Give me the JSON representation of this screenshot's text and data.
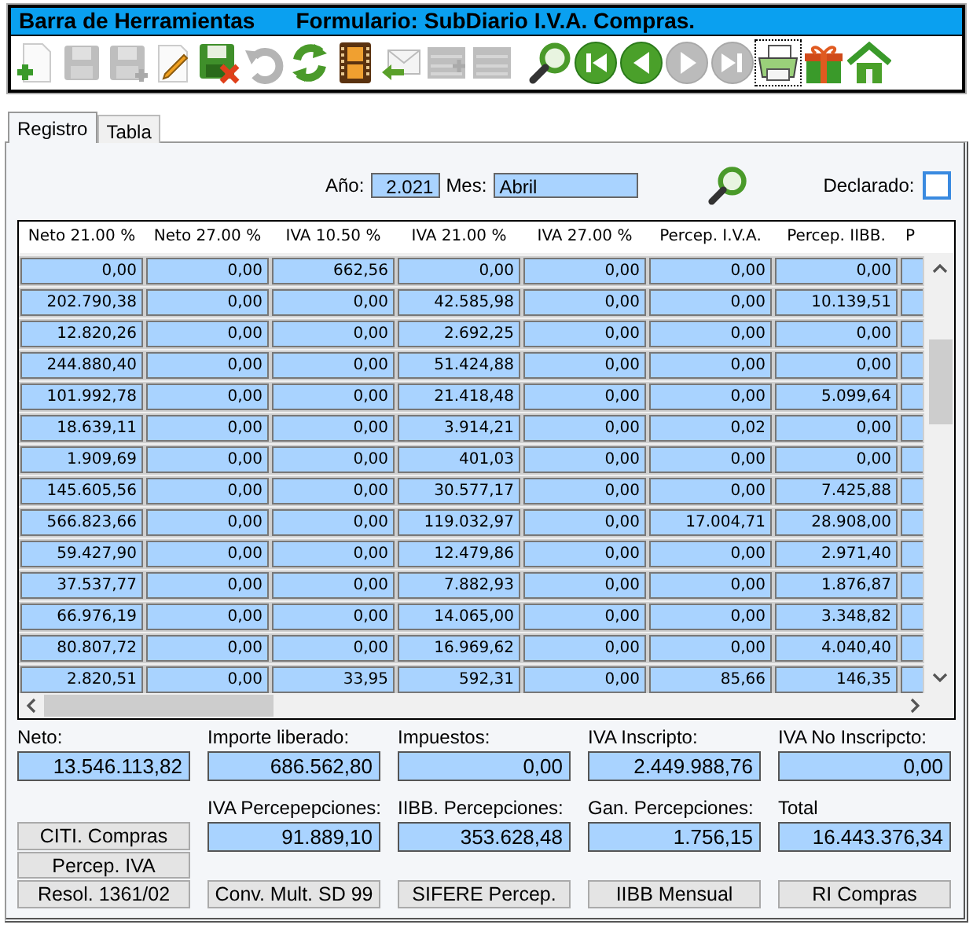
{
  "window": {
    "title": "Barra de Herramientas",
    "form_title": "Formulario: SubDiario I.V.A. Compras."
  },
  "toolbar": [
    {
      "kind": "new",
      "disabled": false,
      "focused": false
    },
    {
      "kind": "save",
      "disabled": true,
      "focused": false
    },
    {
      "kind": "save_as",
      "disabled": true,
      "focused": false
    },
    {
      "kind": "edit",
      "disabled": false,
      "focused": false
    },
    {
      "kind": "save_cancel",
      "disabled": false,
      "focused": false
    },
    {
      "kind": "undo",
      "disabled": true,
      "focused": false
    },
    {
      "kind": "refresh",
      "disabled": false,
      "focused": false
    },
    {
      "kind": "film",
      "disabled": false,
      "focused": false
    },
    {
      "kind": "mail_back",
      "disabled": false,
      "focused": false
    },
    {
      "kind": "list_add",
      "disabled": true,
      "focused": false
    },
    {
      "kind": "list",
      "disabled": true,
      "focused": false
    },
    {
      "kind": "search",
      "disabled": false,
      "focused": false
    },
    {
      "kind": "first",
      "disabled": false,
      "focused": false
    },
    {
      "kind": "prev",
      "disabled": false,
      "focused": false
    },
    {
      "kind": "next",
      "disabled": true,
      "focused": false
    },
    {
      "kind": "last",
      "disabled": true,
      "focused": false
    },
    {
      "kind": "print",
      "disabled": false,
      "focused": true
    },
    {
      "kind": "gift",
      "disabled": false,
      "focused": false
    },
    {
      "kind": "home",
      "disabled": false,
      "focused": false
    }
  ],
  "tabs": [
    {
      "label": "Registro",
      "selected": true
    },
    {
      "label": "Tabla",
      "selected": false
    }
  ],
  "filters": {
    "year_label": "Año:",
    "year": "2.021",
    "month_label": "Mes:",
    "month": "Abril",
    "declared_label": "Declarado:",
    "declared": false
  },
  "table": {
    "columns": [
      "Neto 21.00 %",
      "Neto 27.00 %",
      "IVA 10.50 %",
      "IVA 21.00 %",
      "IVA 27.00 %",
      "Percep. I.V.A.",
      "Percep. IIBB.",
      "P"
    ],
    "rows": [
      [
        "0,00",
        "0,00",
        "662,56",
        "0,00",
        "0,00",
        "0,00",
        "0,00"
      ],
      [
        "202.790,38",
        "0,00",
        "0,00",
        "42.585,98",
        "0,00",
        "0,00",
        "10.139,51"
      ],
      [
        "12.820,26",
        "0,00",
        "0,00",
        "2.692,25",
        "0,00",
        "0,00",
        "0,00"
      ],
      [
        "244.880,40",
        "0,00",
        "0,00",
        "51.424,88",
        "0,00",
        "0,00",
        "0,00"
      ],
      [
        "101.992,78",
        "0,00",
        "0,00",
        "21.418,48",
        "0,00",
        "0,00",
        "5.099,64"
      ],
      [
        "18.639,11",
        "0,00",
        "0,00",
        "3.914,21",
        "0,00",
        "0,02",
        "0,00"
      ],
      [
        "1.909,69",
        "0,00",
        "0,00",
        "401,03",
        "0,00",
        "0,00",
        "0,00"
      ],
      [
        "145.605,56",
        "0,00",
        "0,00",
        "30.577,17",
        "0,00",
        "0,00",
        "7.425,88"
      ],
      [
        "566.823,66",
        "0,00",
        "0,00",
        "119.032,97",
        "0,00",
        "17.004,71",
        "28.908,00"
      ],
      [
        "59.427,90",
        "0,00",
        "0,00",
        "12.479,86",
        "0,00",
        "0,00",
        "2.971,40"
      ],
      [
        "37.537,77",
        "0,00",
        "0,00",
        "7.882,93",
        "0,00",
        "0,00",
        "1.876,87"
      ],
      [
        "66.976,19",
        "0,00",
        "0,00",
        "14.065,00",
        "0,00",
        "0,00",
        "3.348,82"
      ],
      [
        "80.807,72",
        "0,00",
        "0,00",
        "16.969,62",
        "0,00",
        "0,00",
        "4.040,40"
      ],
      [
        "2.820,51",
        "0,00",
        "33,95",
        "592,31",
        "0,00",
        "85,66",
        "146,35"
      ]
    ]
  },
  "totals_top": [
    {
      "label": "Neto:",
      "value": "13.546.113,82"
    },
    {
      "label": "Importe liberado:",
      "value": "686.562,80"
    },
    {
      "label": "Impuestos:",
      "value": "0,00"
    },
    {
      "label": "IVA Inscripto:",
      "value": "2.449.988,76"
    },
    {
      "label": "IVA No Inscripcto:",
      "value": "0,00"
    }
  ],
  "totals_bottom": [
    {
      "label": "IVA Percepepciones:",
      "value": "91.889,10"
    },
    {
      "label": "IIBB. Percepciones:",
      "value": "353.628,48"
    },
    {
      "label": "Gan. Percepciones:",
      "value": "1.756,15"
    },
    {
      "label": "Total",
      "value": "16.443.376,34"
    }
  ],
  "side_buttons": [
    "CITI. Compras",
    "Percep. IVA",
    "Resol. 1361/02"
  ],
  "bottom_buttons": [
    "Conv. Mult. SD 99",
    "SIFERE Percep.",
    "IIBB Mensual",
    "RI Compras"
  ]
}
